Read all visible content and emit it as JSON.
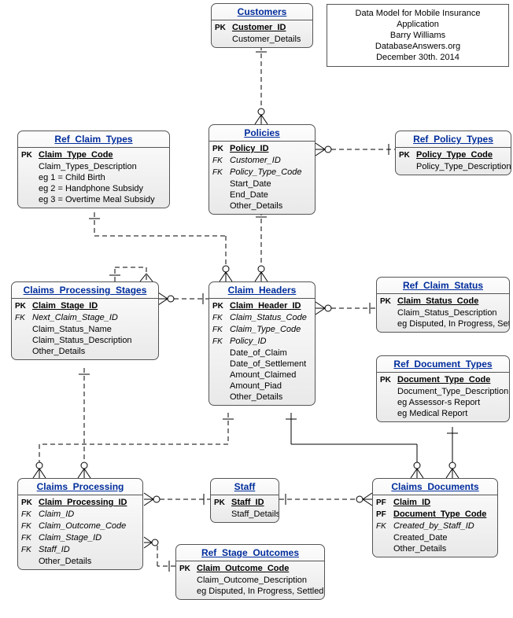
{
  "info_box": {
    "line1": "Data Model for Mobile Insurance Application",
    "line2": "Barry Williams",
    "line3": "DatabaseAnswers.org",
    "line4": "December 30th. 2014"
  },
  "entities": {
    "customers": {
      "title": "Customers",
      "pk_label": "PK",
      "pk_name": "Customer_ID",
      "attr1": "Customer_Details"
    },
    "policies": {
      "title": "Policies",
      "pk_label": "PK",
      "pk_name": "Policy_ID",
      "fk1_label": "FK",
      "fk1_name": "Customer_ID",
      "fk2_label": "FK",
      "fk2_name": "Policy_Type_Code",
      "attr1": "Start_Date",
      "attr2": "End_Date",
      "attr3": "Other_Details"
    },
    "ref_policy_types": {
      "title": "Ref_Policy_Types",
      "pk_label": "PK",
      "pk_name": "Policy_Type_Code",
      "attr1": "Policy_Type_Description"
    },
    "ref_claim_types": {
      "title": "Ref_Claim_Types",
      "pk_label": "PK",
      "pk_name": "Claim_Type_Code",
      "attr1": "Claim_Types_Description",
      "note1": "eg 1 = Child Birth",
      "note2": "eg 2 = Handphone Subsidy",
      "note3": "eg 3 = Overtime Meal Subsidy"
    },
    "claims_processing_stages": {
      "title": "Claims_Processing_Stages",
      "pk_label": "PK",
      "pk_name": "Claim_Stage_ID",
      "fk1_label": "FK",
      "fk1_name": "Next_Claim_Stage_ID",
      "attr1": "Claim_Status_Name",
      "attr2": "Claim_Status_Description",
      "attr3": "Other_Details"
    },
    "claim_headers": {
      "title": "Claim_Headers",
      "pk_label": "PK",
      "pk_name": "Claim_Header_ID",
      "fk1_label": "FK",
      "fk1_name": "Claim_Status_Code",
      "fk2_label": "FK",
      "fk2_name": "Claim_Type_Code",
      "fk3_label": "FK",
      "fk3_name": "Policy_ID",
      "attr1": "Date_of_Claim",
      "attr2": "Date_of_Settlement",
      "attr3": "Amount_Claimed",
      "attr4": "Amount_Piad",
      "attr5": "Other_Details"
    },
    "ref_claim_status": {
      "title": "Ref_Claim_Status",
      "pk_label": "PK",
      "pk_name": "Claim_Status_Code",
      "attr1": "Claim_Status_Description",
      "note1": "eg Disputed, In Progress, Settled"
    },
    "ref_document_types": {
      "title": "Ref_Document_Types",
      "pk_label": "PK",
      "pk_name": "Document_Type_Code",
      "attr1": "Document_Type_Description",
      "note1": "eg Assessor-s Report",
      "note2": "eg Medical Report"
    },
    "claims_processing": {
      "title": "Claims_Processing",
      "pk_label": "PK",
      "pk_name": "Claim_Processing_ID",
      "fk1_label": "FK",
      "fk1_name": "Claim_ID",
      "fk2_label": "FK",
      "fk2_name": "Claim_Outcome_Code",
      "fk3_label": "FK",
      "fk3_name": "Claim_Stage_ID",
      "fk4_label": "FK",
      "fk4_name": "Staff_ID",
      "attr1": "Other_Details"
    },
    "staff": {
      "title": "Staff",
      "pk_label": "PK",
      "pk_name": "Staff_ID",
      "attr1": "Staff_Details"
    },
    "claims_documents": {
      "title": "Claims_Documents",
      "pf1_label": "PF",
      "pf1_name": "Claim_ID",
      "pf2_label": "PF",
      "pf2_name": "Document_Type_Code",
      "fk1_label": "FK",
      "fk1_name": "Created_by_Staff_ID",
      "attr1": "Created_Date",
      "attr2": "Other_Details"
    },
    "ref_stage_outcomes": {
      "title": "Ref_Stage_Outcomes",
      "pk_label": "PK",
      "pk_name": "Claim_Outcome_Code",
      "attr1": "Claim_Outcome_Description",
      "note1": "eg Disputed, In Progress, Settled"
    }
  }
}
